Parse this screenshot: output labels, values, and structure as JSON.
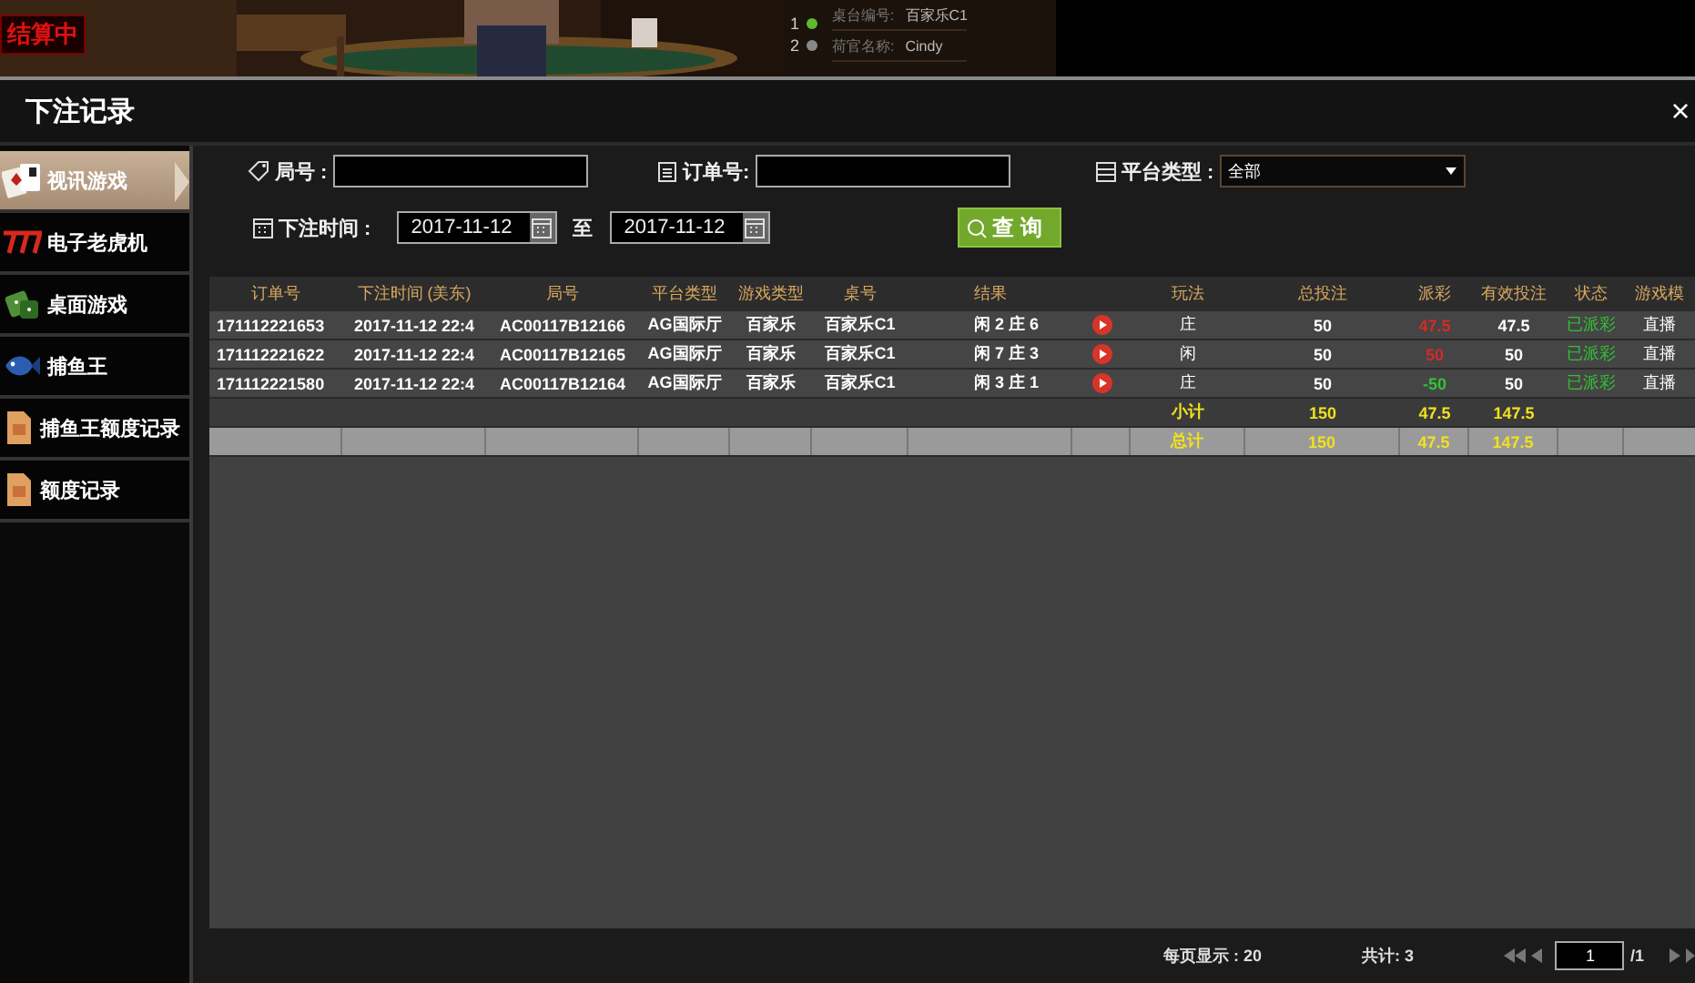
{
  "live_preview": {
    "kind": "picture",
    "status": "结算中",
    "road_numbers": [
      {
        "label": "1",
        "selected": true
      },
      {
        "label": "2",
        "selected": false
      }
    ],
    "table_info": [
      {
        "label": "桌台编号:",
        "value": "百家乐C1"
      },
      {
        "label": "荷官名称:",
        "value": "Cindy"
      }
    ]
  },
  "dialog": {
    "title": "下注记录",
    "close": "×"
  },
  "sidebar": {
    "items": [
      {
        "label": "视讯游戏",
        "kind": "cards",
        "selected": true
      },
      {
        "label": "电子老虎机",
        "kind": "slot",
        "selected": false
      },
      {
        "label": "桌面游戏",
        "kind": "dice",
        "selected": false
      },
      {
        "label": "捕鱼王",
        "kind": "fish",
        "selected": false
      },
      {
        "label": "捕鱼王额度记录",
        "kind": "doc",
        "selected": false
      },
      {
        "label": "额度记录",
        "kind": "doc",
        "selected": false
      }
    ]
  },
  "filters": {
    "round_label": "局号 :",
    "order_label": "订单号:",
    "platform_label": "平台类型 :",
    "platform_value": "全部",
    "time_label": "下注时间 :",
    "date_from": "2017-11-12",
    "to_label": "至",
    "date_to": "2017-11-12",
    "search_button": "查 询"
  },
  "table": {
    "columns": [
      "订单号",
      "下注时间 (美东)",
      "局号",
      "平台类型",
      "游戏类型",
      "桌号",
      "结果",
      "",
      "玩法",
      "总投注",
      "派彩",
      "有效投注",
      "状态",
      "游戏模"
    ],
    "rows": [
      {
        "order": "171112221653",
        "time": "2017-11-12 22:4",
        "round": "AC00117B12166",
        "platform": "AG国际厅",
        "game": "百家乐",
        "table_no": "百家乐C1",
        "result": "闲 2 庄 6",
        "play": "庄",
        "bet": "50",
        "payout": "47.5",
        "color": "#d42a2a",
        "valid": "47.5",
        "status": "已派彩",
        "mode": "直播"
      },
      {
        "order": "171112221622",
        "time": "2017-11-12 22:4",
        "round": "AC00117B12165",
        "platform": "AG国际厅",
        "game": "百家乐",
        "table_no": "百家乐C1",
        "result": "闲 7 庄 3",
        "play": "闲",
        "bet": "50",
        "payout": "50",
        "color": "#d42a2a",
        "valid": "50",
        "status": "已派彩",
        "mode": "直播"
      },
      {
        "order": "171112221580",
        "time": "2017-11-12 22:4",
        "round": "AC00117B12164",
        "platform": "AG国际厅",
        "game": "百家乐",
        "table_no": "百家乐C1",
        "result": "闲 3 庄 1",
        "play": "庄",
        "bet": "50",
        "payout": "-50",
        "color": "#33c233",
        "valid": "50",
        "status": "已派彩",
        "mode": "直播"
      }
    ],
    "totals": [
      {
        "kind": "subtotal",
        "label": "小计",
        "bet": "150",
        "payout": "47.5",
        "valid": "147.5"
      },
      {
        "kind": "total",
        "label": "总计",
        "bet": "150",
        "payout": "47.5",
        "valid": "147.5"
      }
    ]
  },
  "pagination": {
    "per_page": "每页显示 : 20",
    "total": "共计: 3",
    "page": "1",
    "pages": "/1"
  }
}
